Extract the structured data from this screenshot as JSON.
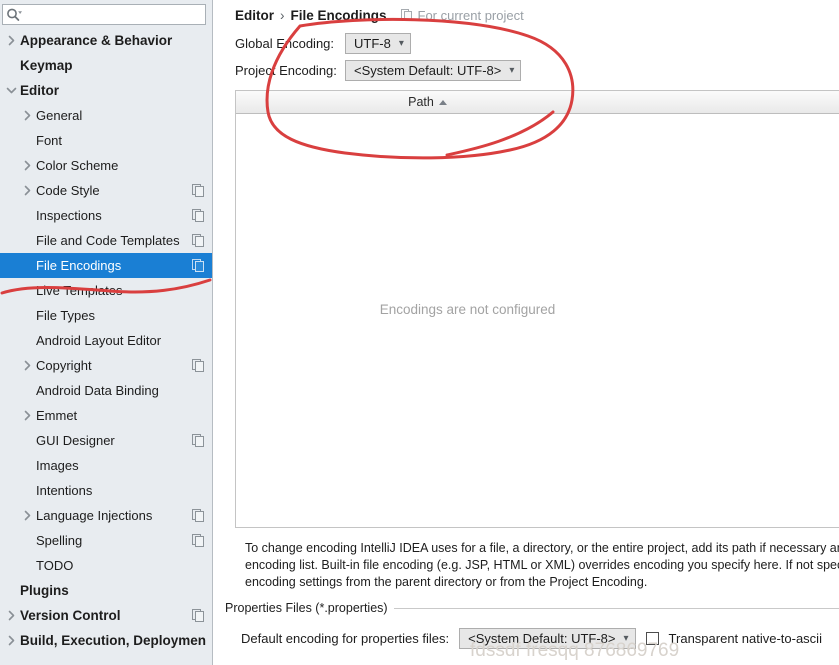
{
  "sidebar": {
    "search": {
      "value": "",
      "placeholder": "",
      "icon": "search-icon"
    },
    "items": [
      {
        "label": "Appearance & Behavior",
        "level": 0,
        "twisty": "right",
        "badge": false
      },
      {
        "label": "Keymap",
        "level": 0,
        "twisty": "none",
        "badge": false
      },
      {
        "label": "Editor",
        "level": 0,
        "twisty": "down",
        "badge": false
      },
      {
        "label": "General",
        "level": 1,
        "twisty": "right",
        "badge": false
      },
      {
        "label": "Font",
        "level": 1,
        "twisty": "none",
        "badge": false
      },
      {
        "label": "Color Scheme",
        "level": 1,
        "twisty": "right",
        "badge": false
      },
      {
        "label": "Code Style",
        "level": 1,
        "twisty": "right",
        "badge": true
      },
      {
        "label": "Inspections",
        "level": 1,
        "twisty": "none",
        "badge": true
      },
      {
        "label": "File and Code Templates",
        "level": 1,
        "twisty": "none",
        "badge": true
      },
      {
        "label": "File Encodings",
        "level": 1,
        "twisty": "none",
        "badge": true,
        "selected": true
      },
      {
        "label": "Live Templates",
        "level": 1,
        "twisty": "none",
        "badge": false
      },
      {
        "label": "File Types",
        "level": 1,
        "twisty": "none",
        "badge": false
      },
      {
        "label": "Android Layout Editor",
        "level": 1,
        "twisty": "none",
        "badge": false
      },
      {
        "label": "Copyright",
        "level": 1,
        "twisty": "right",
        "badge": true
      },
      {
        "label": "Android Data Binding",
        "level": 1,
        "twisty": "none",
        "badge": false
      },
      {
        "label": "Emmet",
        "level": 1,
        "twisty": "right",
        "badge": false
      },
      {
        "label": "GUI Designer",
        "level": 1,
        "twisty": "none",
        "badge": true
      },
      {
        "label": "Images",
        "level": 1,
        "twisty": "none",
        "badge": false
      },
      {
        "label": "Intentions",
        "level": 1,
        "twisty": "none",
        "badge": false
      },
      {
        "label": "Language Injections",
        "level": 1,
        "twisty": "right",
        "badge": true
      },
      {
        "label": "Spelling",
        "level": 1,
        "twisty": "none",
        "badge": true
      },
      {
        "label": "TODO",
        "level": 1,
        "twisty": "none",
        "badge": false
      },
      {
        "label": "Plugins",
        "level": 0,
        "twisty": "none",
        "badge": false
      },
      {
        "label": "Version Control",
        "level": 0,
        "twisty": "right",
        "badge": true
      },
      {
        "label": "Build, Execution, Deployment",
        "level": 0,
        "twisty": "right",
        "badge": false
      }
    ]
  },
  "main": {
    "breadcrumb": {
      "parent": "Editor",
      "separator": "›",
      "current": "File Encodings"
    },
    "scope_note": {
      "label": "For current project",
      "icon": "project-scope-icon"
    },
    "global_encoding": {
      "label": "Global Encoding:",
      "value": "UTF-8"
    },
    "project_encoding": {
      "label": "Project Encoding:",
      "value": "<System Default: UTF-8>"
    },
    "table": {
      "columns": [
        "Path"
      ],
      "sort": "ascending",
      "rows": [],
      "empty_text": "Encodings are not configured"
    },
    "description": "To change encoding IntelliJ IDEA uses for a file, a directory, or the entire project, add its path if necessary and then\nencoding list. Built-in file encoding (e.g. JSP, HTML or XML) overrides encoding you specify here. If not specified,\nencoding settings from the parent directory or from the Project Encoding.",
    "properties_group": {
      "title": "Properties Files (*.properties)",
      "default_encoding_label": "Default encoding for properties files:",
      "default_encoding_value": "<System Default: UTF-8>",
      "transparent_label": "Transparent native-to-ascii",
      "transparent_checked": false
    },
    "watermark": "fdssdf fresqq 876869769"
  },
  "colors": {
    "selection": "#1a7fd4",
    "sidebar_bg": "#e8ecf0",
    "annotation": "#d93f3f",
    "empty_text": "#a3a3a3"
  }
}
